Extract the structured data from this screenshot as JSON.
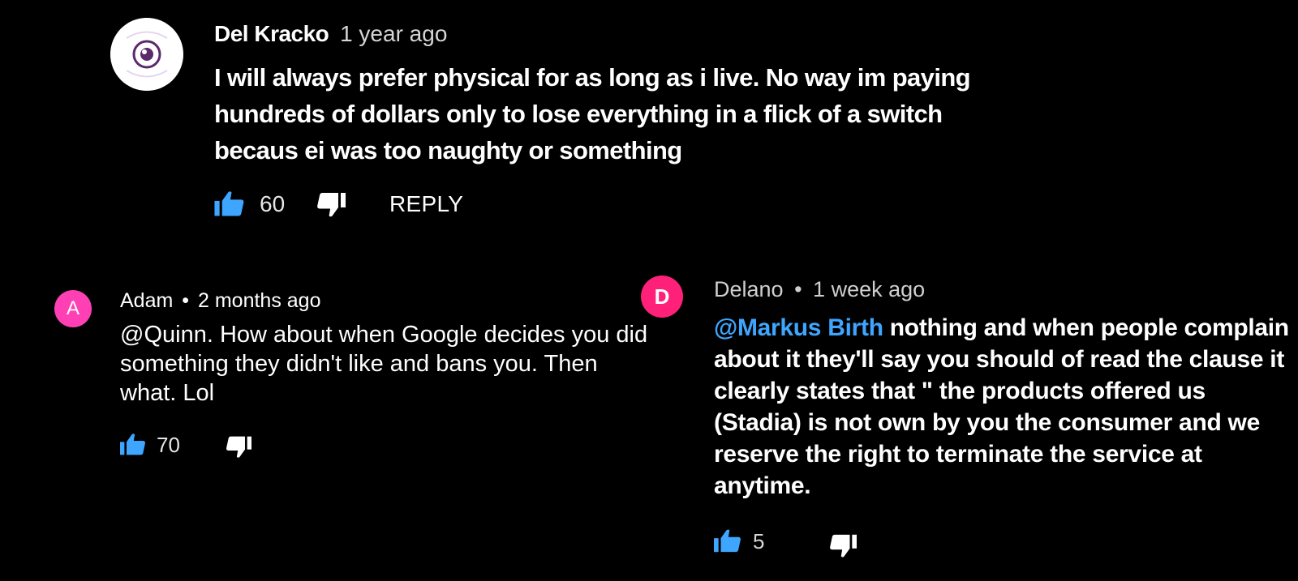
{
  "colors": {
    "background": "#000000",
    "like_icon": "#3ea6ff",
    "mention": "#3ea6ff",
    "avatar_adam": "#ff3fb4",
    "avatar_delano": "#ff2079"
  },
  "comments": [
    {
      "author": "Del Kracko",
      "time": "1 year ago",
      "avatar_icon": "eye-logo-icon",
      "text": "I will always prefer physical for as long as i live. No way im paying hundreds of dollars only to lose everything in a flick of a switch becaus ei was too naughty or something",
      "likes": "60",
      "reply_label": "REPLY"
    },
    {
      "author": "Adam",
      "separator": "•",
      "time": "2 months ago",
      "avatar_letter": "A",
      "text": "@Quinn. How about when Google decides you did something they didn't like and bans you. Then what. Lol",
      "likes": "70"
    },
    {
      "author": "Delano",
      "separator": "•",
      "time": "1 week ago",
      "avatar_letter": "D",
      "mention": "@Markus Birth",
      "text": " nothing and when people complain about it they'll say you should of read the clause it clearly states that \" the products offered us (Stadia) is not own by you the consumer and we reserve the right to terminate the service at anytime.",
      "likes": "5"
    }
  ]
}
